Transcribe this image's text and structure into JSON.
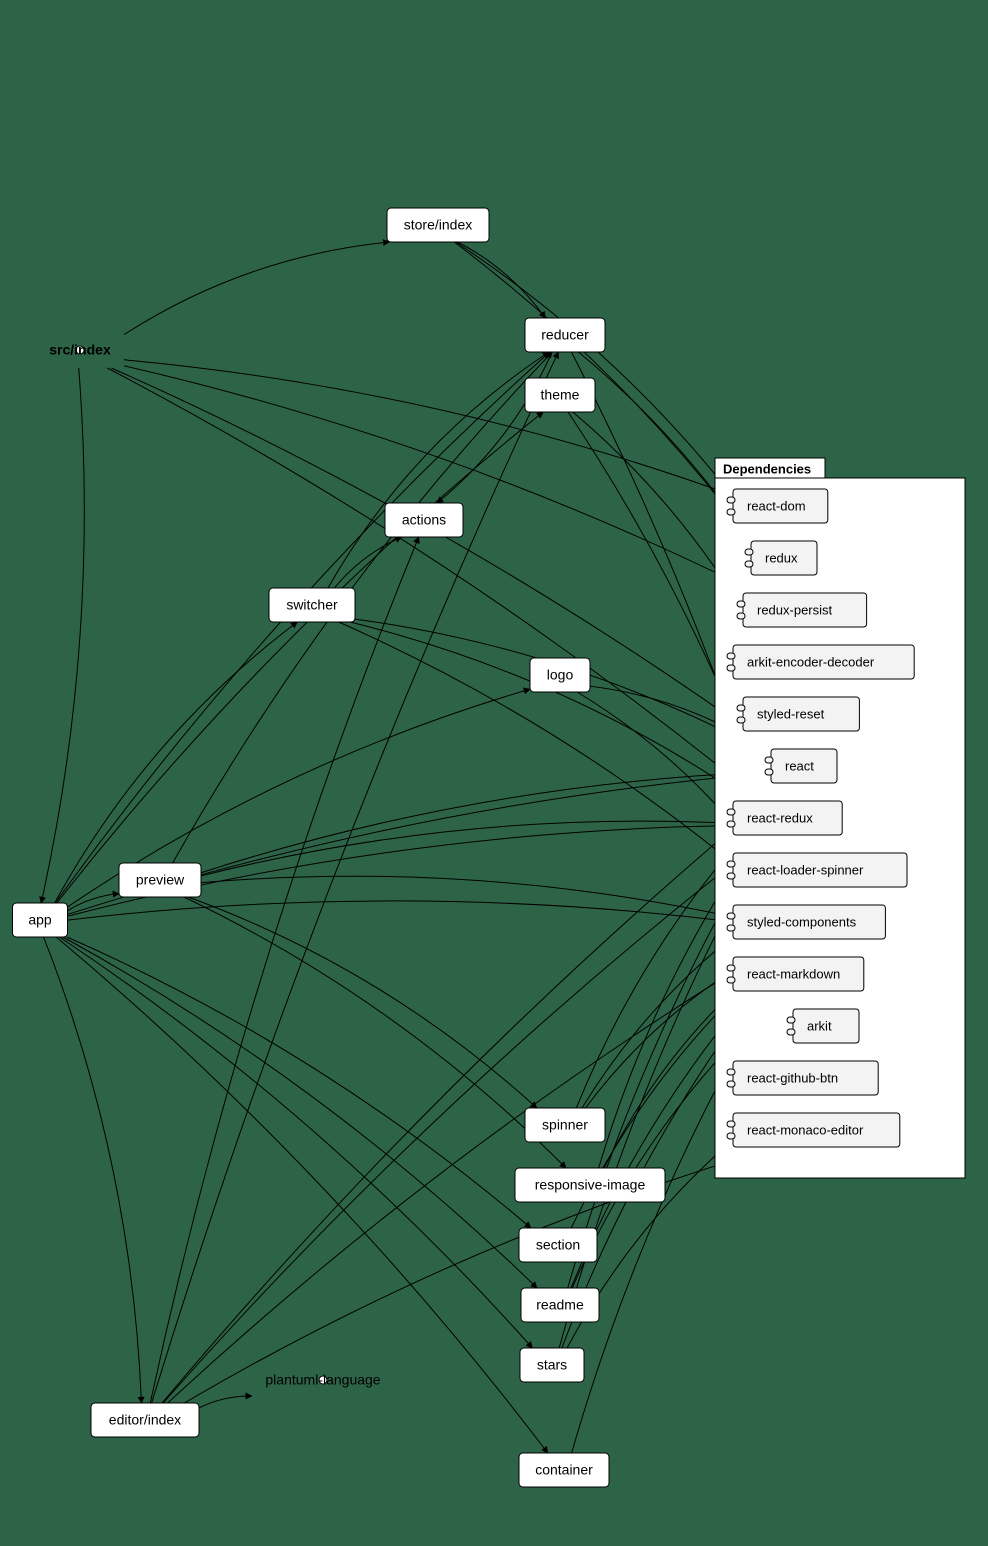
{
  "diagram": {
    "type": "dependency-graph",
    "entry_points": [
      "src/index",
      "plantuml-language"
    ],
    "modules": {
      "src_index": {
        "label": "src/index",
        "shape": "ellipse",
        "bold": true
      },
      "store_index": {
        "label": "store/index",
        "shape": "rect"
      },
      "reducer": {
        "label": "reducer",
        "shape": "rect"
      },
      "theme": {
        "label": "theme",
        "shape": "rect"
      },
      "actions": {
        "label": "actions",
        "shape": "rect"
      },
      "switcher": {
        "label": "switcher",
        "shape": "rect"
      },
      "logo": {
        "label": "logo",
        "shape": "rect"
      },
      "preview": {
        "label": "preview",
        "shape": "rect"
      },
      "app": {
        "label": "app",
        "shape": "rect"
      },
      "spinner": {
        "label": "spinner",
        "shape": "rect"
      },
      "responsive_image": {
        "label": "responsive-image",
        "shape": "rect"
      },
      "section": {
        "label": "section",
        "shape": "rect"
      },
      "readme": {
        "label": "readme",
        "shape": "rect"
      },
      "stars": {
        "label": "stars",
        "shape": "rect"
      },
      "container": {
        "label": "container",
        "shape": "rect"
      },
      "editor_index": {
        "label": "editor/index",
        "shape": "rect"
      },
      "plantuml_language": {
        "label": "plantuml-language",
        "shape": "ellipse"
      }
    },
    "dependencies_group": {
      "title": "Dependencies",
      "items": [
        {
          "key": "react_dom",
          "label": "react-dom"
        },
        {
          "key": "redux",
          "label": "redux"
        },
        {
          "key": "redux_persist",
          "label": "redux-persist"
        },
        {
          "key": "arkit_encoder_decoder",
          "label": "arkit-encoder-decoder"
        },
        {
          "key": "styled_reset",
          "label": "styled-reset"
        },
        {
          "key": "react",
          "label": "react"
        },
        {
          "key": "react_redux",
          "label": "react-redux"
        },
        {
          "key": "react_loader_spinner",
          "label": "react-loader-spinner"
        },
        {
          "key": "styled_components",
          "label": "styled-components"
        },
        {
          "key": "react_markdown",
          "label": "react-markdown"
        },
        {
          "key": "arkit",
          "label": "arkit"
        },
        {
          "key": "react_github_btn",
          "label": "react-github-btn"
        },
        {
          "key": "react_monaco_editor",
          "label": "react-monaco-editor"
        }
      ]
    },
    "edges": [
      [
        "src_index",
        "store_index"
      ],
      [
        "src_index",
        "app"
      ],
      [
        "src_index",
        "react_dom"
      ],
      [
        "src_index",
        "react"
      ],
      [
        "src_index",
        "react_redux"
      ],
      [
        "src_index",
        "redux_persist"
      ],
      [
        "store_index",
        "reducer"
      ],
      [
        "store_index",
        "redux"
      ],
      [
        "store_index",
        "redux_persist"
      ],
      [
        "reducer",
        "actions"
      ],
      [
        "reducer",
        "arkit_encoder_decoder"
      ],
      [
        "reducer",
        "arkit"
      ],
      [
        "theme",
        "styled_reset"
      ],
      [
        "theme",
        "styled_components"
      ],
      [
        "switcher",
        "actions"
      ],
      [
        "switcher",
        "reducer"
      ],
      [
        "switcher",
        "react"
      ],
      [
        "switcher",
        "react_redux"
      ],
      [
        "switcher",
        "styled_components"
      ],
      [
        "logo",
        "react"
      ],
      [
        "logo",
        "styled_components"
      ],
      [
        "preview",
        "spinner"
      ],
      [
        "preview",
        "responsive_image"
      ],
      [
        "preview",
        "reducer"
      ],
      [
        "preview",
        "react"
      ],
      [
        "preview",
        "react_redux"
      ],
      [
        "preview",
        "styled_components"
      ],
      [
        "app",
        "theme"
      ],
      [
        "app",
        "switcher"
      ],
      [
        "app",
        "logo"
      ],
      [
        "app",
        "preview"
      ],
      [
        "app",
        "section"
      ],
      [
        "app",
        "readme"
      ],
      [
        "app",
        "stars"
      ],
      [
        "app",
        "container"
      ],
      [
        "app",
        "editor_index"
      ],
      [
        "app",
        "reducer"
      ],
      [
        "app",
        "react"
      ],
      [
        "app",
        "react_redux"
      ],
      [
        "app",
        "styled_components"
      ],
      [
        "spinner",
        "react"
      ],
      [
        "spinner",
        "react_loader_spinner"
      ],
      [
        "spinner",
        "styled_components"
      ],
      [
        "responsive_image",
        "react"
      ],
      [
        "responsive_image",
        "styled_components"
      ],
      [
        "section",
        "styled_components"
      ],
      [
        "readme",
        "react"
      ],
      [
        "readme",
        "react_markdown"
      ],
      [
        "readme",
        "styled_components"
      ],
      [
        "stars",
        "react"
      ],
      [
        "stars",
        "react_github_btn"
      ],
      [
        "stars",
        "styled_components"
      ],
      [
        "container",
        "styled_components"
      ],
      [
        "editor_index",
        "actions"
      ],
      [
        "editor_index",
        "reducer"
      ],
      [
        "editor_index",
        "plantuml_language"
      ],
      [
        "editor_index",
        "react"
      ],
      [
        "editor_index",
        "react_redux"
      ],
      [
        "editor_index",
        "react_monaco_editor"
      ],
      [
        "editor_index",
        "styled_components"
      ]
    ]
  }
}
